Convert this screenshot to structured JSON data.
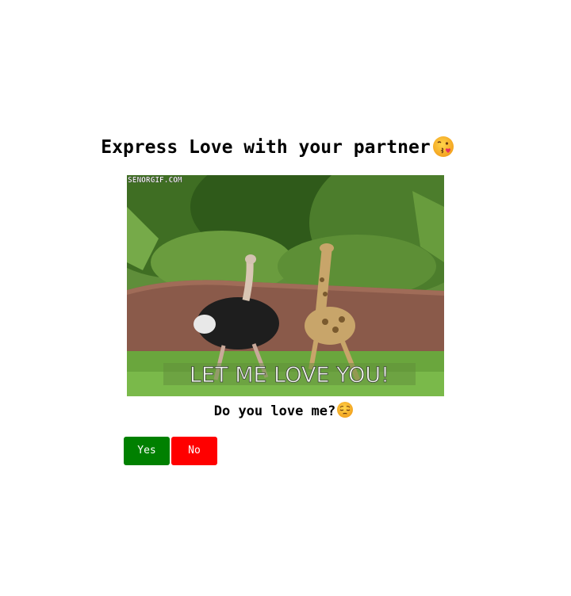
{
  "header": {
    "title": "Express Love with your partner",
    "title_emoji": "face-blowing-a-kiss-icon"
  },
  "gif": {
    "watermark": "SENORGIF.COM",
    "caption": "LET ME LOVE YOU!"
  },
  "question": {
    "text": "Do you love me?",
    "emoji": "pensive-face-icon"
  },
  "buttons": {
    "yes_label": "Yes",
    "no_label": "No"
  },
  "colors": {
    "yes": "#008000",
    "no": "#ff0000",
    "emoji": "#f5b12e"
  }
}
